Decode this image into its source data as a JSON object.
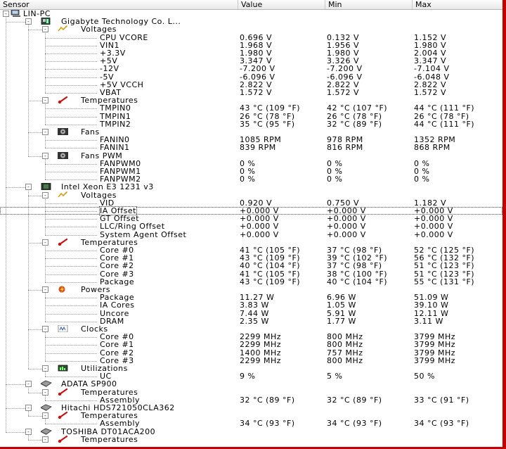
{
  "headers": {
    "sensor": "Sensor",
    "value": "Value",
    "min": "Min",
    "max": "Max"
  },
  "rows": [
    {
      "d": 0,
      "k": "root",
      "t": "LIN-PC",
      "i": "computer-icon",
      "e": "-"
    },
    {
      "d": 1,
      "k": "device",
      "t": "Gigabyte Technology Co. L...",
      "i": "motherboard-icon",
      "e": "-"
    },
    {
      "d": 2,
      "k": "group",
      "t": "Voltages",
      "i": "voltage-icon",
      "e": "-"
    },
    {
      "d": 3,
      "k": "sensor",
      "t": "CPU VCORE",
      "v": "0.696 V",
      "mn": "0.132 V",
      "mx": "1.152 V"
    },
    {
      "d": 3,
      "k": "sensor",
      "t": "VIN1",
      "v": "1.968 V",
      "mn": "1.956 V",
      "mx": "1.980 V"
    },
    {
      "d": 3,
      "k": "sensor",
      "t": "+3.3V",
      "v": "1.980 V",
      "mn": "1.980 V",
      "mx": "2.004 V"
    },
    {
      "d": 3,
      "k": "sensor",
      "t": "+5V",
      "v": "3.347 V",
      "mn": "3.326 V",
      "mx": "3.347 V"
    },
    {
      "d": 3,
      "k": "sensor",
      "t": "-12V",
      "v": "-7.200 V",
      "mn": "-7.200 V",
      "mx": "-7.104 V"
    },
    {
      "d": 3,
      "k": "sensor",
      "t": "-5V",
      "v": "-6.096 V",
      "mn": "-6.096 V",
      "mx": "-6.048 V"
    },
    {
      "d": 3,
      "k": "sensor",
      "t": "+5V VCCH",
      "v": "2.822 V",
      "mn": "2.822 V",
      "mx": "2.822 V"
    },
    {
      "d": 3,
      "k": "sensor",
      "t": "VBAT",
      "v": "1.572 V",
      "mn": "1.572 V",
      "mx": "1.572 V"
    },
    {
      "d": 2,
      "k": "group",
      "t": "Temperatures",
      "i": "thermometer-icon",
      "e": "-"
    },
    {
      "d": 3,
      "k": "sensor",
      "t": "TMPIN0",
      "v": "43 °C  (109 °F)",
      "mn": "42 °C  (107 °F)",
      "mx": "44 °C  (111 °F)"
    },
    {
      "d": 3,
      "k": "sensor",
      "t": "TMPIN1",
      "v": "26 °C  (78 °F)",
      "mn": "26 °C  (78 °F)",
      "mx": "26 °C  (78 °F)"
    },
    {
      "d": 3,
      "k": "sensor",
      "t": "TMPIN2",
      "v": "35 °C  (95 °F)",
      "mn": "32 °C  (89 °F)",
      "mx": "44 °C  (111 °F)"
    },
    {
      "d": 2,
      "k": "group",
      "t": "Fans",
      "i": "fan-icon",
      "e": "-"
    },
    {
      "d": 3,
      "k": "sensor",
      "t": "FANIN0",
      "v": "1085 RPM",
      "mn": "978 RPM",
      "mx": "1352 RPM"
    },
    {
      "d": 3,
      "k": "sensor",
      "t": "FANIN1",
      "v": "839 RPM",
      "mn": "816 RPM",
      "mx": "868 RPM"
    },
    {
      "d": 2,
      "k": "group",
      "t": "Fans PWM",
      "i": "fan-icon",
      "e": "-"
    },
    {
      "d": 3,
      "k": "sensor",
      "t": "FANPWM0",
      "v": "0 %",
      "mn": "0 %",
      "mx": "0 %"
    },
    {
      "d": 3,
      "k": "sensor",
      "t": "FANPWM1",
      "v": "0 %",
      "mn": "0 %",
      "mx": "0 %"
    },
    {
      "d": 3,
      "k": "sensor",
      "t": "FANPWM2",
      "v": "0 %",
      "mn": "0 %",
      "mx": "0 %"
    },
    {
      "d": 1,
      "k": "device",
      "t": "Intel Xeon E3 1231 v3",
      "i": "cpu-icon",
      "e": "-"
    },
    {
      "d": 2,
      "k": "group",
      "t": "Voltages",
      "i": "voltage-icon",
      "e": "-"
    },
    {
      "d": 3,
      "k": "sensor",
      "t": "VID",
      "v": "0.920 V",
      "mn": "0.750 V",
      "mx": "1.182 V"
    },
    {
      "d": 3,
      "k": "sensor",
      "t": "IA Offset",
      "v": "+0.000 V",
      "mn": "+0.000 V",
      "mx": "+0.000 V",
      "sel": true
    },
    {
      "d": 3,
      "k": "sensor",
      "t": "GT Offset",
      "v": "+0.000 V",
      "mn": "+0.000 V",
      "mx": "+0.000 V"
    },
    {
      "d": 3,
      "k": "sensor",
      "t": "LLC/Ring Offset",
      "v": "+0.000 V",
      "mn": "+0.000 V",
      "mx": "+0.000 V"
    },
    {
      "d": 3,
      "k": "sensor",
      "t": "System Agent Offset",
      "v": "+0.000 V",
      "mn": "+0.000 V",
      "mx": "+0.000 V"
    },
    {
      "d": 2,
      "k": "group",
      "t": "Temperatures",
      "i": "thermometer-icon",
      "e": "-"
    },
    {
      "d": 3,
      "k": "sensor",
      "t": "Core #0",
      "v": "41 °C  (105 °F)",
      "mn": "37 °C  (98 °F)",
      "mx": "52 °C  (125 °F)"
    },
    {
      "d": 3,
      "k": "sensor",
      "t": "Core #1",
      "v": "43 °C  (109 °F)",
      "mn": "39 °C  (102 °F)",
      "mx": "56 °C  (132 °F)"
    },
    {
      "d": 3,
      "k": "sensor",
      "t": "Core #2",
      "v": "40 °C  (104 °F)",
      "mn": "37 °C  (98 °F)",
      "mx": "51 °C  (123 °F)"
    },
    {
      "d": 3,
      "k": "sensor",
      "t": "Core #3",
      "v": "41 °C  (105 °F)",
      "mn": "38 °C  (100 °F)",
      "mx": "51 °C  (123 °F)"
    },
    {
      "d": 3,
      "k": "sensor",
      "t": "Package",
      "v": "43 °C  (109 °F)",
      "mn": "40 °C  (104 °F)",
      "mx": "55 °C  (131 °F)"
    },
    {
      "d": 2,
      "k": "group",
      "t": "Powers",
      "i": "power-icon",
      "e": "-"
    },
    {
      "d": 3,
      "k": "sensor",
      "t": "Package",
      "v": "11.27 W",
      "mn": "6.96 W",
      "mx": "51.09 W"
    },
    {
      "d": 3,
      "k": "sensor",
      "t": "IA Cores",
      "v": "3.83 W",
      "mn": "1.05 W",
      "mx": "39.10 W"
    },
    {
      "d": 3,
      "k": "sensor",
      "t": "Uncore",
      "v": "7.44 W",
      "mn": "5.91 W",
      "mx": "12.11 W"
    },
    {
      "d": 3,
      "k": "sensor",
      "t": "DRAM",
      "v": "2.35 W",
      "mn": "1.77 W",
      "mx": "3.11 W"
    },
    {
      "d": 2,
      "k": "group",
      "t": "Clocks",
      "i": "clock-icon",
      "e": "-"
    },
    {
      "d": 3,
      "k": "sensor",
      "t": "Core #0",
      "v": "2299 MHz",
      "mn": "800 MHz",
      "mx": "3799 MHz"
    },
    {
      "d": 3,
      "k": "sensor",
      "t": "Core #1",
      "v": "2299 MHz",
      "mn": "800 MHz",
      "mx": "3799 MHz"
    },
    {
      "d": 3,
      "k": "sensor",
      "t": "Core #2",
      "v": "1400 MHz",
      "mn": "757 MHz",
      "mx": "3799 MHz"
    },
    {
      "d": 3,
      "k": "sensor",
      "t": "Core #3",
      "v": "2299 MHz",
      "mn": "800 MHz",
      "mx": "3799 MHz"
    },
    {
      "d": 2,
      "k": "group",
      "t": "Utilizations",
      "i": "utilization-icon",
      "e": "-"
    },
    {
      "d": 3,
      "k": "sensor",
      "t": "UC",
      "v": "9 %",
      "mn": "5 %",
      "mx": "50 %"
    },
    {
      "d": 1,
      "k": "device",
      "t": "ADATA SP900",
      "i": "disk-icon",
      "e": "-"
    },
    {
      "d": 2,
      "k": "group",
      "t": "Temperatures",
      "i": "thermometer-icon",
      "e": "-"
    },
    {
      "d": 3,
      "k": "sensor",
      "t": "Assembly",
      "v": "32 °C  (89 °F)",
      "mn": "32 °C  (89 °F)",
      "mx": "33 °C  (91 °F)"
    },
    {
      "d": 1,
      "k": "device",
      "t": "Hitachi HDS721050CLA362",
      "i": "disk-icon",
      "e": "-"
    },
    {
      "d": 2,
      "k": "group",
      "t": "Temperatures",
      "i": "thermometer-icon",
      "e": "-"
    },
    {
      "d": 3,
      "k": "sensor",
      "t": "Assembly",
      "v": "34 °C  (93 °F)",
      "mn": "34 °C  (93 °F)",
      "mx": "34 °C  (93 °F)"
    },
    {
      "d": 1,
      "k": "device",
      "t": "TOSHIBA DT01ACA200",
      "i": "disk-icon",
      "e": "-"
    },
    {
      "d": 2,
      "k": "group",
      "t": "Temperatures",
      "i": "thermometer-icon",
      "e": "-"
    }
  ]
}
